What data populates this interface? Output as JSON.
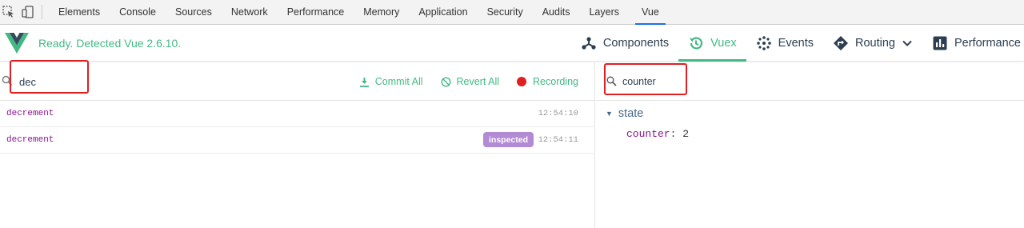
{
  "devtools": {
    "tabs": [
      "Elements",
      "Console",
      "Sources",
      "Network",
      "Performance",
      "Memory",
      "Application",
      "Security",
      "Audits",
      "Layers",
      "Vue"
    ],
    "active_tab": "Vue",
    "icons": [
      "inspect-element-icon",
      "device-toolbar-icon"
    ]
  },
  "vue_header": {
    "status": "Ready. Detected Vue 2.6.10.",
    "nav": [
      {
        "label": "Components",
        "icon": "components-icon"
      },
      {
        "label": "Vuex",
        "icon": "history-icon",
        "active": true
      },
      {
        "label": "Events",
        "icon": "events-icon"
      },
      {
        "label": "Routing",
        "icon": "routing-icon",
        "dropdown": true
      },
      {
        "label": "Performance",
        "icon": "bar-chart-icon"
      }
    ]
  },
  "mutations": {
    "search_value": "dec",
    "actions": {
      "commit_all": "Commit All",
      "revert_all": "Revert All",
      "recording": "Recording"
    },
    "rows": [
      {
        "name": "decrement",
        "time": "12:54:10",
        "badge": ""
      },
      {
        "name": "decrement",
        "time": "12:54:11",
        "badge": "inspected"
      }
    ]
  },
  "state_panel": {
    "search_value": "counter",
    "section": "state",
    "entries": [
      {
        "key": "counter",
        "value": "2"
      }
    ]
  },
  "colors": {
    "vue_green": "#42b983",
    "highlight_red": "#e02020",
    "badge_purple": "#b28bd4",
    "key_purple": "#881391"
  }
}
